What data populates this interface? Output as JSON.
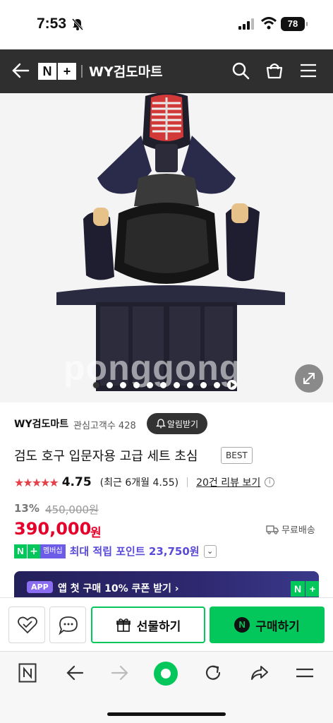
{
  "status_bar": {
    "time": "7:53",
    "battery": "78"
  },
  "header": {
    "store_name": "WY검도마트",
    "nplus_n": "N",
    "nplus_plus": "+"
  },
  "hero": {
    "watermark": "ponggong",
    "slide_count": 10,
    "active_slide": 0
  },
  "product": {
    "seller": "WY검도마트",
    "followers": "관심고객수 428",
    "alarm_button": "알림받기",
    "title": "검도 호구 입문자용 고급 세트 초심",
    "badge": "BEST",
    "stars": "★★★★★",
    "rating": "4.75",
    "recent_rating": "(최근 6개월 4.55)",
    "reviews_link": "20건 리뷰 보기",
    "discount": "13%",
    "original_price": "450,000원",
    "price": "390,000",
    "price_unit": "원",
    "shipping": "무료배송",
    "membership_label": "멤버십",
    "points_text": "최대 적립 포인트 23,750원"
  },
  "banner": {
    "app_label": "APP",
    "text": "앱 첫 구매 10% 쿠폰 받기 ›"
  },
  "actions": {
    "gift": "선물하기",
    "buy": "구매하기",
    "buy_icon": "N"
  },
  "colors": {
    "accent_green": "#03c75a",
    "price_red": "#e5002b",
    "purple": "#5a4ad8",
    "header_bg": "#2f2f2f"
  }
}
